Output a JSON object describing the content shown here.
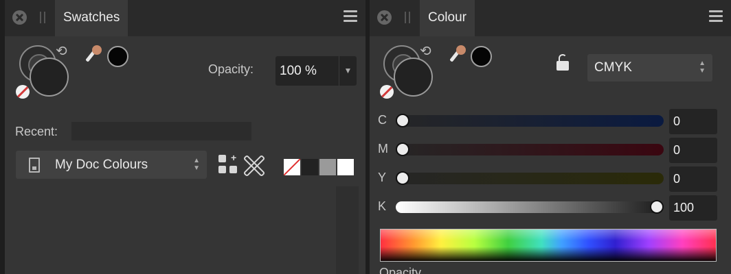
{
  "swatches_panel": {
    "tab_label": "Swatches",
    "opacity_label": "Opacity:",
    "opacity_value": "100 %",
    "recent_label": "Recent:",
    "palette_selected": "My Doc Colours",
    "swatch_colors": [
      "none",
      "#222222",
      "#9a9a9a",
      "#ffffff"
    ],
    "icons": {
      "close": "close-icon",
      "grip": "grip-icon",
      "menu": "hamburger-menu-icon",
      "swap": "swap-arrows-icon",
      "picker": "color-picker-icon",
      "no_fill": "no-fill-icon",
      "document": "document-icon",
      "add_swatch": "add-swatch-icon",
      "remove_swatch": "remove-swatch-icon"
    }
  },
  "colour_panel": {
    "tab_label": "Colour",
    "model": "CMYK",
    "opacity_label": "Opacity",
    "channels": [
      {
        "label": "C",
        "value": "0",
        "fraction": 0.0
      },
      {
        "label": "M",
        "value": "0",
        "fraction": 0.0
      },
      {
        "label": "Y",
        "value": "0",
        "fraction": 0.0
      },
      {
        "label": "K",
        "value": "100",
        "fraction": 1.0
      }
    ],
    "icons": {
      "close": "close-icon",
      "grip": "grip-icon",
      "menu": "hamburger-menu-icon",
      "lock": "lock-icon",
      "picker": "color-picker-icon",
      "no_fill": "no-fill-icon"
    }
  },
  "colors": {
    "panel_bg": "#353535",
    "tabbar_bg": "#2a2a2a",
    "field_bg": "#242424",
    "accent_none": "#d23a3a"
  }
}
